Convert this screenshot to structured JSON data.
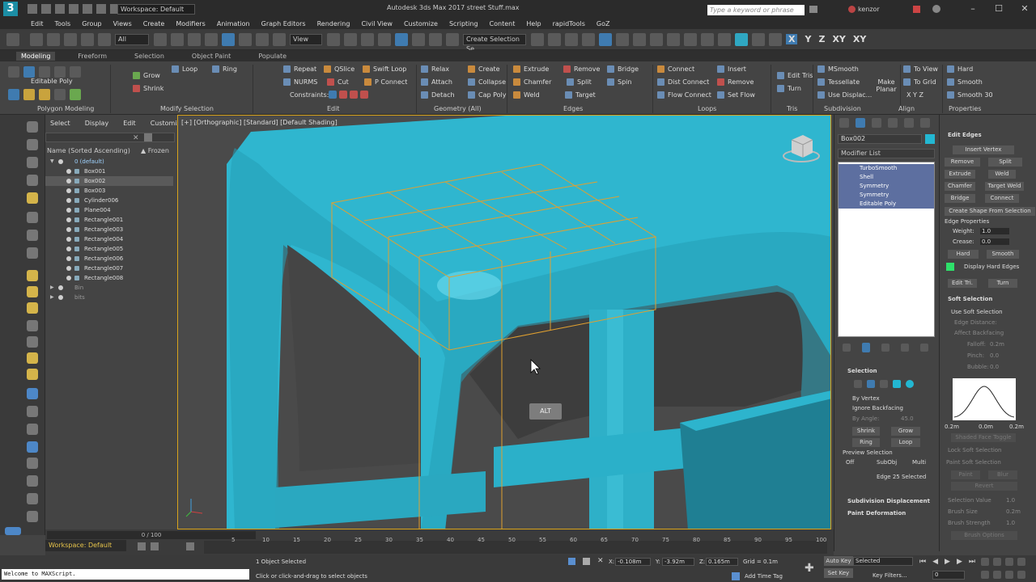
{
  "titlebar": {
    "workspace": "Workspace: Default",
    "title": "Autodesk 3ds Max 2017      street Stuff.max",
    "search_placeholder": "Type a keyword or phrase",
    "user": "kenzor"
  },
  "menus": [
    "Edit",
    "Tools",
    "Group",
    "Views",
    "Create",
    "Modifiers",
    "Animation",
    "Graph Editors",
    "Rendering",
    "Civil View",
    "Customize",
    "Scripting",
    "Content",
    "Help",
    "rapidTools",
    "GoZ"
  ],
  "toolbar": {
    "filter_drop": "All",
    "view_drop": "View",
    "selection_set": "Create Selection Se",
    "axes": [
      "X",
      "Y",
      "Z",
      "XY",
      "XY"
    ]
  },
  "ribbon_tabs": [
    "Modeling",
    "Freeform",
    "Selection",
    "Object Paint",
    "Populate"
  ],
  "ribbon": {
    "editable_poly": "Editable Poly",
    "grow": "Grow",
    "shrink": "Shrink",
    "loop": "Loop",
    "ring": "Ring",
    "repeat": "Repeat",
    "qslice": "QSlice",
    "swift_loop": "Swift Loop",
    "nurms": "NURMS",
    "cut": "Cut",
    "p_connect": "P Connect",
    "constraints": "Constraints:",
    "relax": "Relax",
    "create": "Create",
    "attach": "Attach",
    "collapse": "Collapse",
    "detach": "Detach",
    "cap_poly": "Cap Poly",
    "extrude": "Extrude",
    "remove": "Remove",
    "bridge": "Bridge",
    "chamfer": "Chamfer",
    "split": "Split",
    "weld": "Weld",
    "spin": "Spin",
    "target": "Target",
    "connect": "Connect",
    "dist_connect": "Dist Connect",
    "flow_connect": "Flow Connect",
    "insert": "Insert",
    "remove2": "Remove",
    "set_flow": "Set Flow",
    "edit_tris": "Edit Tris",
    "turn": "Turn",
    "msmooth": "MSmooth",
    "tessellate": "Tessellate",
    "use_displac": "Use Displac...",
    "make_planar": "Make Planar",
    "to_view": "To View",
    "to_grid": "To Grid",
    "xyz": "X   Y   Z",
    "hard": "Hard",
    "smooth": "Smooth",
    "smooth30": "Smooth 30",
    "groups": [
      "Polygon Modeling",
      "Modify Selection",
      "Edit",
      "Geometry (All)",
      "Edges",
      "Loops",
      "Tris",
      "Subdivision",
      "Align",
      "Properties"
    ]
  },
  "scene_explorer": {
    "menu": [
      "Select",
      "Display",
      "Edit",
      "Customize"
    ],
    "col_name": "Name (Sorted Ascending)",
    "col_frozen": "▲ Frozen",
    "rows": [
      {
        "name": "0 (default)",
        "kind": "layer"
      },
      {
        "name": "Box001",
        "kind": "obj"
      },
      {
        "name": "Box002",
        "kind": "obj-sel"
      },
      {
        "name": "Box003",
        "kind": "obj"
      },
      {
        "name": "Cylinder006",
        "kind": "obj"
      },
      {
        "name": "Plane004",
        "kind": "obj"
      },
      {
        "name": "Rectangle001",
        "kind": "obj"
      },
      {
        "name": "Rectangle003",
        "kind": "obj"
      },
      {
        "name": "Rectangle004",
        "kind": "obj"
      },
      {
        "name": "Rectangle005",
        "kind": "obj"
      },
      {
        "name": "Rectangle006",
        "kind": "obj"
      },
      {
        "name": "Rectangle007",
        "kind": "obj"
      },
      {
        "name": "Rectangle008",
        "kind": "obj"
      },
      {
        "name": "Bin",
        "kind": "layer-dim"
      },
      {
        "name": "bits",
        "kind": "layer-dim"
      }
    ]
  },
  "viewport": {
    "label": "[+] [Orthographic] [Standard] [Default Shading]",
    "alt_key": "ALT"
  },
  "command_panel": {
    "object_name": "Box002",
    "modifier_list": "Modifier List",
    "stack": [
      "TurboSmooth",
      "Shell",
      "Symmetry",
      "Symmetry",
      "Editable Poly"
    ],
    "selection_title": "Selection",
    "by_vertex": "By Vertex",
    "ignore_backfacing": "Ignore Backfacing",
    "by_angle": "By Angle:",
    "by_angle_val": "45.0",
    "shrink": "Shrink",
    "grow": "Grow",
    "ring": "Ring",
    "loop": "Loop",
    "preview_selection": "Preview Selection",
    "off": "Off",
    "subobj": "SubObj",
    "multi": "Multi",
    "edge_selected": "Edge 25 Selected",
    "subdiv_disp": "Subdivision Displacement",
    "paint_deform": "Paint Deformation"
  },
  "edit_edges": {
    "title": "Edit Edges",
    "insert_vertex": "Insert Vertex",
    "remove": "Remove",
    "split": "Split",
    "extrude": "Extrude",
    "weld": "Weld",
    "chamfer": "Chamfer",
    "target_weld": "Target Weld",
    "bridge": "Bridge",
    "connect": "Connect",
    "create_shape": "Create Shape From Selection",
    "edge_props": "Edge Properties",
    "weight": "Weight:",
    "weight_val": "1.0",
    "crease": "Crease:",
    "crease_val": "0.0",
    "hard": "Hard",
    "smooth": "Smooth",
    "display_hard": "Display Hard Edges",
    "edit_tri": "Edit Tri.",
    "turn": "Turn",
    "soft_sel": "Soft Selection",
    "use_soft": "Use Soft Selection",
    "edge_distance": "Edge Distance:",
    "affect_backfacing": "Affect Backfacing",
    "falloff": "Falloff:",
    "falloff_val": "0.2m",
    "pinch": "Pinch:",
    "pinch_val": "0.0",
    "bubble": "Bubble:",
    "bubble_val": "0.0",
    "curve_l": "0.2m",
    "curve_m": "0.0m",
    "curve_r": "0.2m",
    "shaded_face": "Shaded Face Toggle",
    "lock_soft": "Lock Soft Selection",
    "paint_soft": "Paint Soft Selection",
    "paint": "Paint",
    "blur": "Blur",
    "revert": "Revert",
    "sel_value": "Selection Value",
    "sel_value_val": "1.0",
    "brush_size": "Brush Size",
    "brush_size_val": "0.2m",
    "brush_strength": "Brush Strength",
    "brush_strength_val": "1.0",
    "brush_options": "Brush Options"
  },
  "timeline": {
    "slider": "0 / 100",
    "ticks": [
      "5",
      "10",
      "15",
      "20",
      "25",
      "30",
      "35",
      "40",
      "45",
      "50",
      "55",
      "60",
      "65",
      "70",
      "75",
      "80",
      "85",
      "90",
      "95",
      "100"
    ]
  },
  "status": {
    "workspace": "Workspace: Default",
    "maxscript": "Welcome to MAXScript.",
    "objects_selected": "1 Object Selected",
    "prompt": "Click or click-and-drag to select objects",
    "x": "-0.108m",
    "y": "-3.92m",
    "z": "0.165m",
    "grid": "Grid = 0.1m",
    "add_time_tag": "Add Time Tag",
    "auto_key": "Auto Key",
    "set_key": "Set Key",
    "selected": "Selected",
    "key_filters": "Key Filters...",
    "frame": "0"
  }
}
